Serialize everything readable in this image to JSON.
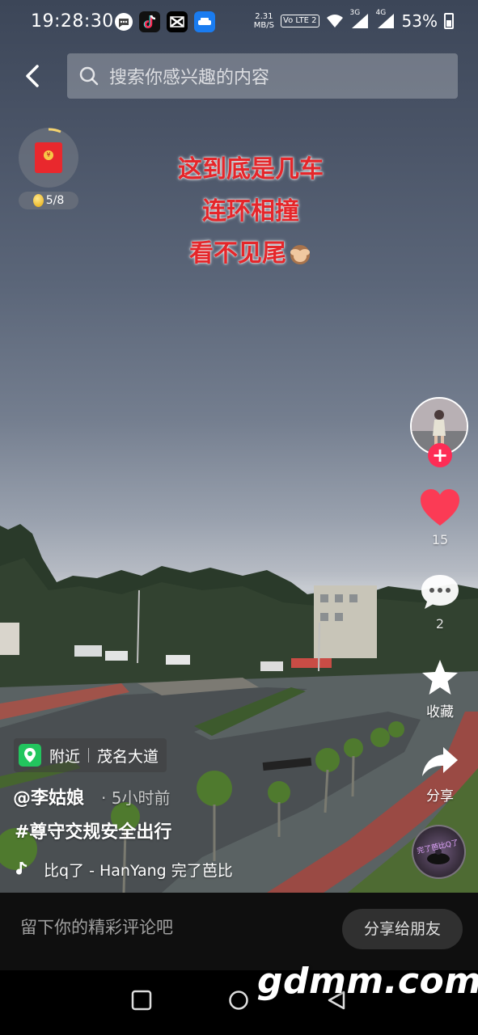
{
  "status_bar": {
    "time": "19:28:30",
    "net_speed_value": "2.31",
    "net_speed_unit": "MB/S",
    "volte": "Vo LTE 2",
    "signal1": "3G",
    "signal2": "4G",
    "battery": "53%"
  },
  "search": {
    "placeholder": "搜索你感兴趣的内容"
  },
  "redpacket": {
    "progress": "5/8"
  },
  "overlay_caption": {
    "lines": [
      "这到底是几车",
      "连环相撞",
      "看不见尾"
    ]
  },
  "actions": {
    "like_count": "15",
    "comment_count": "2",
    "favorite_label": "收藏",
    "share_label": "分享"
  },
  "music_disc_text": "完了芭比Q了",
  "location": {
    "nearby": "附近",
    "place": "茂名大道"
  },
  "post": {
    "author": "@李姑娘",
    "time": "· 5小时前",
    "hashtag": "#尊守交规安全出行",
    "music": "比q了 - HanYang   完了芭比"
  },
  "comment_bar": {
    "placeholder": "留下你的精彩评论吧",
    "share_friends": "分享给朋友"
  },
  "watermark": "gdmm.com",
  "colors": {
    "accent": "#fe2c55",
    "caption": "#e5262a",
    "location_pin": "#22c55e",
    "like_heart": "#fb3b55"
  }
}
